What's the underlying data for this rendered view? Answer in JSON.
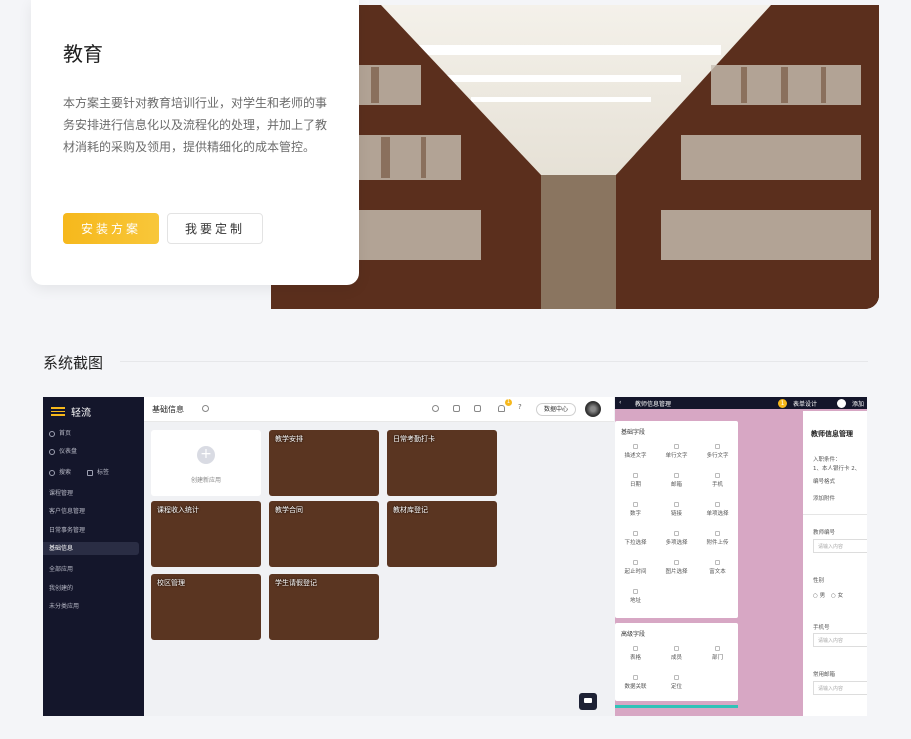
{
  "hero": {
    "title": "教育",
    "description": "本方案主要针对教育培训行业，对学生和老师的事务安排进行信息化以及流程化的处理，并加上了教材消耗的采购及领用，提供精细化的成本管控。",
    "install_label": "安装方案",
    "custom_label": "我要定制"
  },
  "section": {
    "title": "系统截图"
  },
  "app": {
    "brand": "轻流",
    "nav_top": [
      "首页",
      "仪表盘"
    ],
    "search_label": "搜索",
    "tag_label": "标签",
    "nav_items": [
      "课程管理",
      "客户信息管理",
      "日常事务管理",
      "基础信息",
      "全部应用",
      "我创建的",
      "未分类应用"
    ],
    "page_title": "基础信息",
    "data_center": "数据中心",
    "badge": "1",
    "new_app": "创建新应用",
    "tiles": [
      "教学安排",
      "日常考勤打卡",
      "课程收入统计",
      "教学合同",
      "教材库登记",
      "校区管理",
      "学生请假登记"
    ]
  },
  "form_designer": {
    "header": "教师信息管理",
    "step1": "表单设计",
    "step2": "流程设置",
    "step2_short": "添加",
    "basic_title": "基础字段",
    "basic_fields": [
      "描述文字",
      "单行文字",
      "多行文字",
      "日期",
      "邮箱",
      "手机",
      "数字",
      "链接",
      "单项选择",
      "下拉选择",
      "多项选择",
      "附件上传",
      "起止时间",
      "图片选择",
      "富文本",
      "地址"
    ],
    "adv_title": "高级字段",
    "adv_fields": [
      "表格",
      "成员",
      "部门",
      "数据关联",
      "定位"
    ],
    "form_title": "教师信息管理",
    "condition": "入职条件：",
    "condition_detail": "1、本人银行卡 2、",
    "num_format": "编号格式",
    "add_attachment": "添加附件",
    "field_teacher_no": "教师编号",
    "placeholder": "请输入内容",
    "field_gender": "性别",
    "male": "男",
    "female": "女",
    "field_phone": "手机号",
    "field_email": "常用邮箱"
  }
}
